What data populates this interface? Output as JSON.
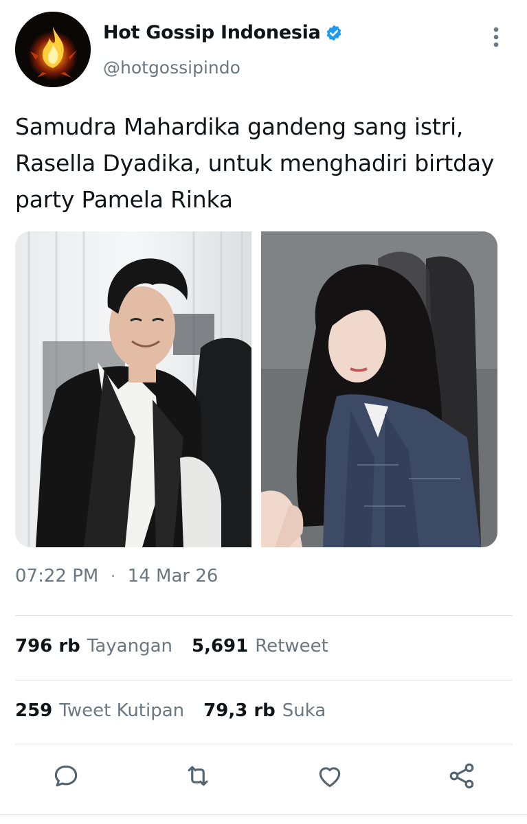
{
  "account": {
    "display_name": "Hot Gossip Indonesia",
    "handle": "@hotgossipindo",
    "avatar_icon": "fire-avatar-icon",
    "verified_icon": "verified-badge-icon",
    "verified_color": "#1d9bf0"
  },
  "tweet": {
    "text": "Samudra Mahardika gandeng sang istri, Rasella Dyadika, untuk menghadiri birtday party Pamela Rinka",
    "time": "07:22 PM",
    "separator": "·",
    "date": "14 Mar 26"
  },
  "stats": {
    "views_count": "796 rb",
    "views_label": "Tayangan",
    "retweets_count": "5,691",
    "retweets_label": "Retweet",
    "quotes_count": "259",
    "quotes_label": "Tweet Kutipan",
    "likes_count": "79,3 rb",
    "likes_label": "Suka"
  },
  "actions": {
    "reply_icon": "reply-icon",
    "retweet_icon": "retweet-icon",
    "like_icon": "heart-icon",
    "share_icon": "share-icon"
  },
  "colors": {
    "text_primary": "#0f1419",
    "text_secondary": "#6b7780",
    "divider": "#dfe3e6"
  }
}
